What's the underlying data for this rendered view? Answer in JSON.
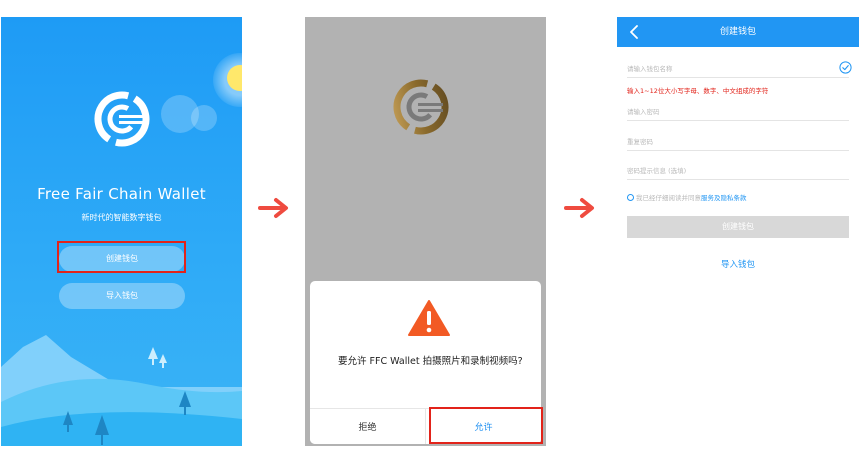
{
  "screen1": {
    "app_title": "Free Fair Chain Wallet",
    "subtitle": "新时代的智能数字钱包",
    "create_button": "创建钱包",
    "import_button": "导入钱包"
  },
  "screen2": {
    "permission_message": "要允许 FFC Wallet 拍摄照片和录制视频吗?",
    "deny_button": "拒绝",
    "allow_button": "允许"
  },
  "screen3": {
    "nav_title": "创建钱包",
    "wallet_name_placeholder": "请输入钱包名称",
    "wallet_name_hint": "输入1~12位大小写字母、数字、中文组成的字符",
    "password_placeholder": "请输入密码",
    "repeat_password_placeholder": "重复密码",
    "password_hint_placeholder": "密码提示信息 (选填)",
    "agree_text": "我已经仔细阅读并同意",
    "terms_link": "服务及隐私条款",
    "create_button": "创建钱包",
    "import_link": "导入钱包"
  },
  "colors": {
    "primary_blue": "#2196f3",
    "highlight_red": "#e2231a",
    "arrow_red": "#ef4b3f",
    "warning_orange": "#f25a24",
    "dim_overlay": "#b2b2b2"
  },
  "icons": [
    "app-logo-icon",
    "sun-icon",
    "arrow-right-icon",
    "warning-icon",
    "back-chevron-icon",
    "check-circle-icon"
  ]
}
